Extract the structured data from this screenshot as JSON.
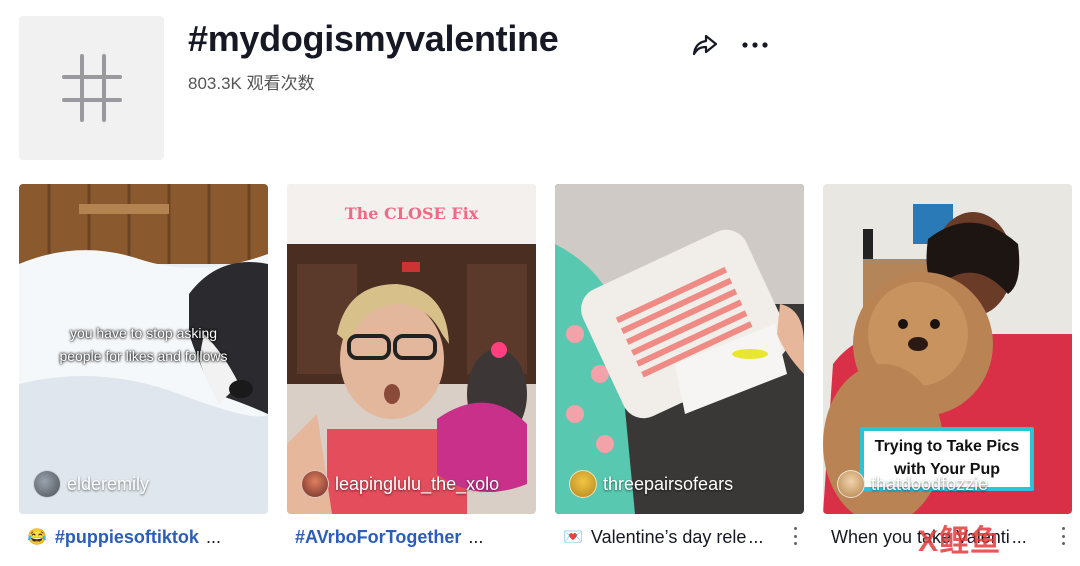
{
  "header": {
    "hashtag": "#mydogismyvalentine",
    "views": "803.3K 观看次数"
  },
  "videos": [
    {
      "overlay_lines": [
        "you have to stop asking",
        "people for likes and follows"
      ],
      "username": "elderemily",
      "caption_emoji": "😂",
      "caption_text": "#puppiesoftiktok",
      "caption_is_link": true
    },
    {
      "overlay_lines": [
        "The CLOSE Fix"
      ],
      "username": "leapinglulu_the_xolo",
      "caption_emoji": "",
      "caption_text": "#AVrboForTogether",
      "caption_is_link": true
    },
    {
      "overlay_lines": [],
      "username": "threepairsofears",
      "caption_emoji": "💌",
      "caption_text": "Valentine’s day rele",
      "caption_is_link": false
    },
    {
      "overlay_lines": [
        "Trying to Take Pics",
        "with Your Pup"
      ],
      "username": "thatdoodfozzie",
      "caption_emoji": "",
      "caption_text": "When you take Valenti",
      "caption_is_link": false
    }
  ],
  "watermark": "X鲤鱼",
  "icons": {
    "share": "share-arrow-icon",
    "more": "more-horizontal-icon",
    "kebab": "more-vertical-icon",
    "hashtag": "hashtag-icon"
  },
  "colors": {
    "link": "#2b5db9",
    "text": "#161823",
    "accent_box": "#2bc4d6"
  }
}
